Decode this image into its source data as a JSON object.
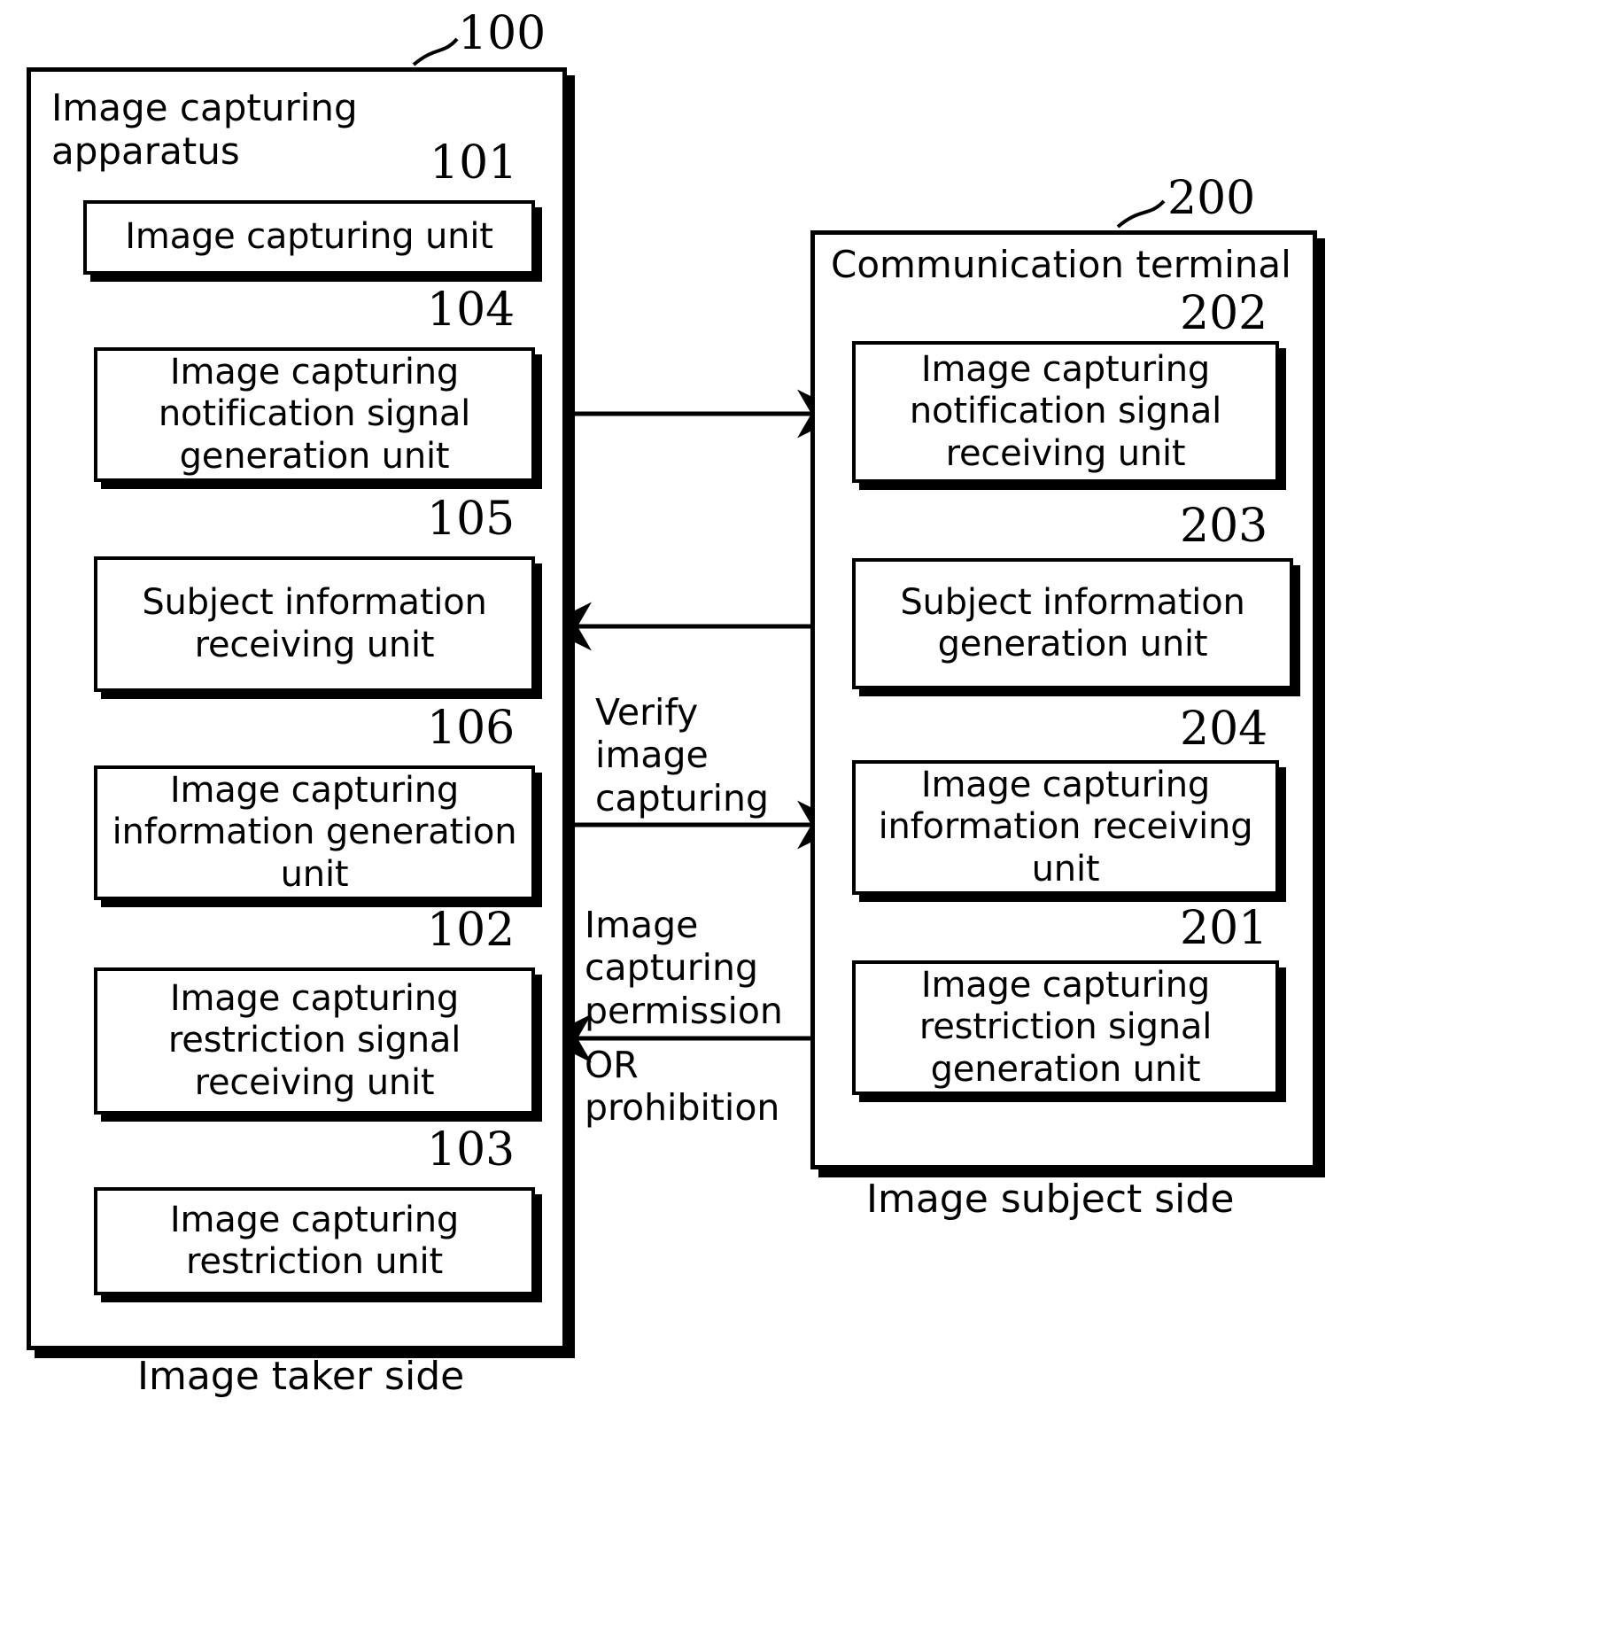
{
  "figure": {
    "type": "patent-block-diagram",
    "left_panel": {
      "numeral": "100",
      "title": "Image capturing\napparatus",
      "caption": "Image taker side",
      "units": [
        {
          "numeral": "101",
          "label": "Image capturing unit"
        },
        {
          "numeral": "104",
          "label": "Image capturing\nnotification signal\ngeneration unit"
        },
        {
          "numeral": "105",
          "label": "Subject information\nreceiving unit"
        },
        {
          "numeral": "106",
          "label": "Image capturing\ninformation\ngeneration unit"
        },
        {
          "numeral": "102",
          "label": "Image capturing\nrestriction signal\nreceiving unit"
        },
        {
          "numeral": "103",
          "label": "Image capturing\nrestriction unit"
        }
      ]
    },
    "right_panel": {
      "numeral": "200",
      "title": "Communication terminal",
      "caption": "Image subject side",
      "units": [
        {
          "numeral": "202",
          "label": "Image capturing\nnotification signal\nreceiving unit"
        },
        {
          "numeral": "203",
          "label": "Subject information\ngeneration unit"
        },
        {
          "numeral": "204",
          "label": "Image capturing\ninformation\nreceiving unit"
        },
        {
          "numeral": "201",
          "label": "Image capturing\nrestriction signal\ngeneration unit"
        }
      ]
    },
    "middle_labels": [
      {
        "id": "verify",
        "text": "Verify\nimage\ncapturing"
      },
      {
        "id": "permission",
        "text": "Image\ncapturing\npermission"
      },
      {
        "id": "or-prohibition",
        "text": "OR\nprohibition"
      }
    ],
    "colors": {
      "ink": "#000000",
      "paper": "#ffffff"
    }
  }
}
